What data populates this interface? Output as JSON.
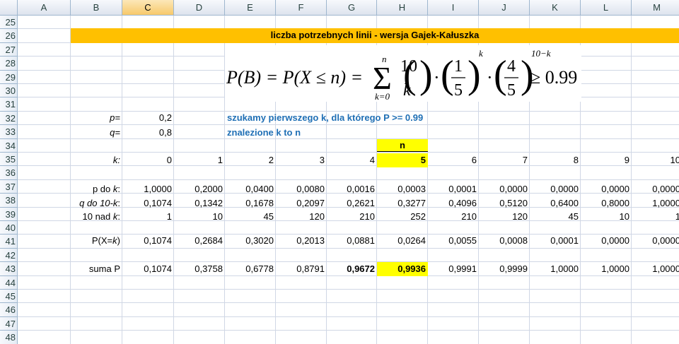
{
  "columns": [
    "A",
    "B",
    "C",
    "D",
    "E",
    "F",
    "G",
    "H",
    "I",
    "J",
    "K",
    "L",
    "M"
  ],
  "rows": [
    "25",
    "26",
    "27",
    "28",
    "29",
    "30",
    "31",
    "32",
    "33",
    "34",
    "35",
    "36",
    "37",
    "38",
    "39",
    "40",
    "41",
    "42",
    "43",
    "44",
    "45",
    "46",
    "47",
    "48"
  ],
  "title": "liczba potrzebnych linii - wersja Gajek-Kałuszka",
  "formula": {
    "lhs": "P(B) = P(X ≤ n) =",
    "sum_upper": "n",
    "sum_lower": "k=0",
    "binom_top": "10",
    "binom_bottom": "k",
    "frac1_num": "1",
    "frac1_den": "5",
    "exp1": "k",
    "frac2_num": "4",
    "frac2_den": "5",
    "exp2": "10−k",
    "rhs": "≥ 0.99"
  },
  "params": {
    "p_label": "p=",
    "p_value": "0,2",
    "q_label": "q=",
    "q_value": "0,8"
  },
  "notes": {
    "line1": "szukamy pierwszego k, dla którego P >= 0.99",
    "line2": "znalezione k to n"
  },
  "n_marker": "n",
  "labels": {
    "k": "k:",
    "pk_prefix": "p do ",
    "pk_var": "k",
    "pk_suffix": ":",
    "qk_prefix": "q do ",
    "qk_var": "10-k",
    "qk_suffix": ":",
    "binom_prefix": "10 nad ",
    "binom_var": "k",
    "binom_suffix": ":",
    "pxk_prefix": "P(X=",
    "pxk_var": "k",
    "pxk_suffix": ")",
    "suma": "suma P"
  },
  "table": {
    "k": [
      "0",
      "1",
      "2",
      "3",
      "4",
      "5",
      "6",
      "7",
      "8",
      "9",
      "10"
    ],
    "p_pow": [
      "1,0000",
      "0,2000",
      "0,0400",
      "0,0080",
      "0,0016",
      "0,0003",
      "0,0001",
      "0,0000",
      "0,0000",
      "0,0000",
      "0,0000"
    ],
    "q_pow": [
      "0,1074",
      "0,1342",
      "0,1678",
      "0,2097",
      "0,2621",
      "0,3277",
      "0,4096",
      "0,5120",
      "0,6400",
      "0,8000",
      "1,0000"
    ],
    "binom": [
      "1",
      "10",
      "45",
      "120",
      "210",
      "252",
      "210",
      "120",
      "45",
      "10",
      "1"
    ],
    "pxk": [
      "0,1074",
      "0,2684",
      "0,3020",
      "0,2013",
      "0,0881",
      "0,0264",
      "0,0055",
      "0,0008",
      "0,0001",
      "0,0000",
      "0,0000"
    ],
    "suma": [
      "0,1074",
      "0,3758",
      "0,6778",
      "0,8791",
      "0,9672",
      "0,9936",
      "0,9991",
      "0,9999",
      "1,0000",
      "1,0000",
      "1,0000"
    ]
  },
  "colors": {
    "title_bg": "#ffc000",
    "highlight": "#ffff00",
    "note_text": "#1f6fb5",
    "grid": "#d0d7e5"
  }
}
